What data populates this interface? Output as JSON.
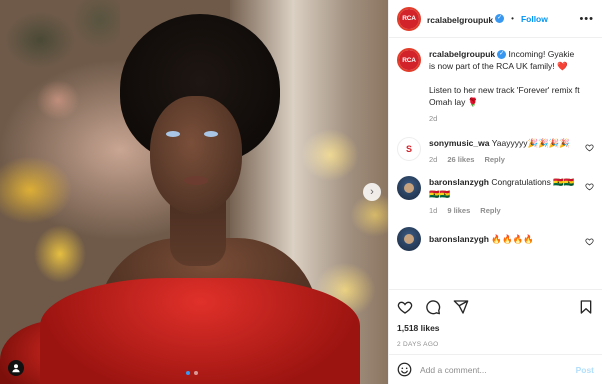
{
  "post": {
    "username": "rcalabelgroupuk",
    "follow_label": "Follow",
    "separator": "•",
    "more_label": "•••",
    "brand_color": "#d2232a",
    "avatar_text": "RCA"
  },
  "caption": {
    "username": "rcalabelgroupuk",
    "text": "Incoming! Gyakie is now part of the RCA UK family! ❤️",
    "text2": "Listen to her new track 'Forever' remix ft Omah lay 🌹",
    "time": "2d"
  },
  "comments": [
    {
      "username": "sonymusic_wa",
      "text": "Yaayyyyy🎉🎉🎉🎉",
      "time": "2d",
      "likes": "26 likes",
      "reply": "Reply",
      "avatar_text": "SONY MUSIC"
    },
    {
      "username": "baronslanzygh",
      "text": "Congratulations 🇬🇭🇬🇭🇬🇭🇬🇭",
      "time": "1d",
      "likes": "9 likes",
      "reply": "Reply"
    },
    {
      "username": "baronslanzygh",
      "text": "🔥🔥🔥🔥"
    }
  ],
  "stats": {
    "likes": "1,518 likes",
    "ago": "2 DAYS AGO"
  },
  "composer": {
    "placeholder": "Add a comment...",
    "post_label": "Post"
  },
  "icons": {
    "heart": "heart-icon",
    "comment": "comment-icon",
    "share": "share-icon",
    "bookmark": "bookmark-icon",
    "emoji": "emoji-icon",
    "next": "chevron-right-icon"
  }
}
